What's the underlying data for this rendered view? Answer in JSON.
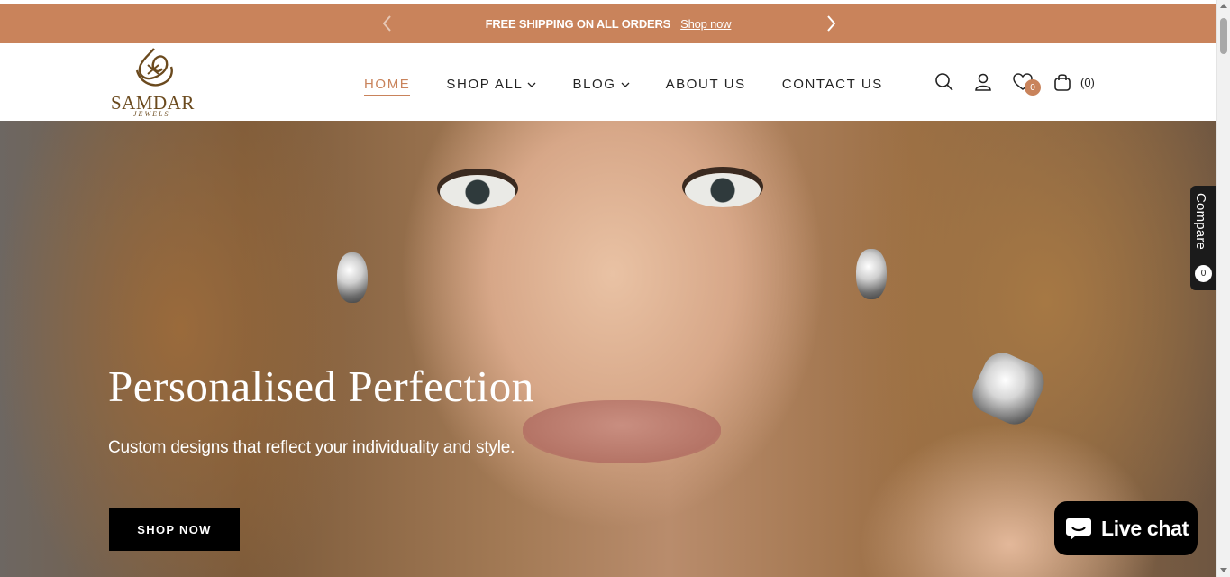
{
  "announcement": {
    "message": "FREE SHIPPING ON ALL ORDERS",
    "link": "Shop now",
    "prev_icon": "chevron-left-icon",
    "next_icon": "chevron-right-icon"
  },
  "brand": {
    "name": "SAMDAR",
    "tagline": "JEWELS"
  },
  "nav": {
    "items": [
      {
        "label": "HOME",
        "active": true
      },
      {
        "label": "SHOP ALL",
        "dropdown": true
      },
      {
        "label": "BLOG",
        "dropdown": true
      },
      {
        "label": "ABOUT US"
      },
      {
        "label": "CONTACT US"
      }
    ]
  },
  "header_icons": {
    "wishlist_count": "0",
    "cart_count": "(0)"
  },
  "hero": {
    "title": "Personalised Perfection",
    "subtitle": "Custom designs that reflect your individuality and style.",
    "cta": "SHOP NOW"
  },
  "compare": {
    "label": "Compare",
    "count": "0"
  },
  "livechat": {
    "label": "Live chat"
  },
  "colors": {
    "accent": "#c9835b",
    "brand_gold": "#6b4a1e",
    "dark": "#000000"
  }
}
